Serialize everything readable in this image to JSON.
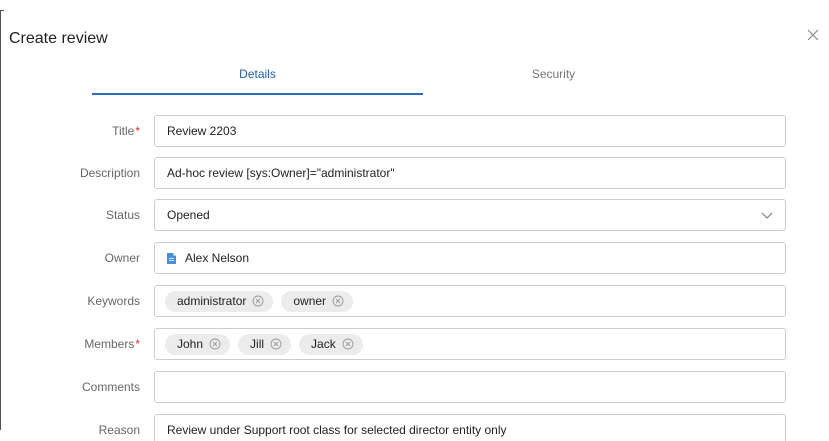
{
  "dialog": {
    "title": "Create review",
    "close_icon": "close-icon"
  },
  "tabs": [
    {
      "label": "Details",
      "active": true
    },
    {
      "label": "Security",
      "active": false
    }
  ],
  "colors": {
    "accent": "#2d6db5",
    "required": "#d9362b",
    "chip_bg": "#ececec",
    "border": "#c9ccd1"
  },
  "form": {
    "title": {
      "label": "Title",
      "required_mark": "*",
      "value": "Review 2203"
    },
    "description": {
      "label": "Description",
      "value": "Ad-hoc review [sys:Owner]=\"administrator\""
    },
    "status": {
      "label": "Status",
      "value": "Opened",
      "icon": "chevron-down-icon"
    },
    "owner": {
      "label": "Owner",
      "value": "Alex Nelson",
      "icon": "document-icon"
    },
    "keywords": {
      "label": "Keywords",
      "chips": [
        "administrator",
        "owner"
      ]
    },
    "members": {
      "label": "Members",
      "required_mark": "*",
      "chips": [
        "John",
        "Jill",
        "Jack"
      ]
    },
    "comments": {
      "label": "Comments",
      "value": ""
    },
    "reason": {
      "label": "Reason",
      "value": "Review under Support root class for selected director entity only"
    }
  }
}
